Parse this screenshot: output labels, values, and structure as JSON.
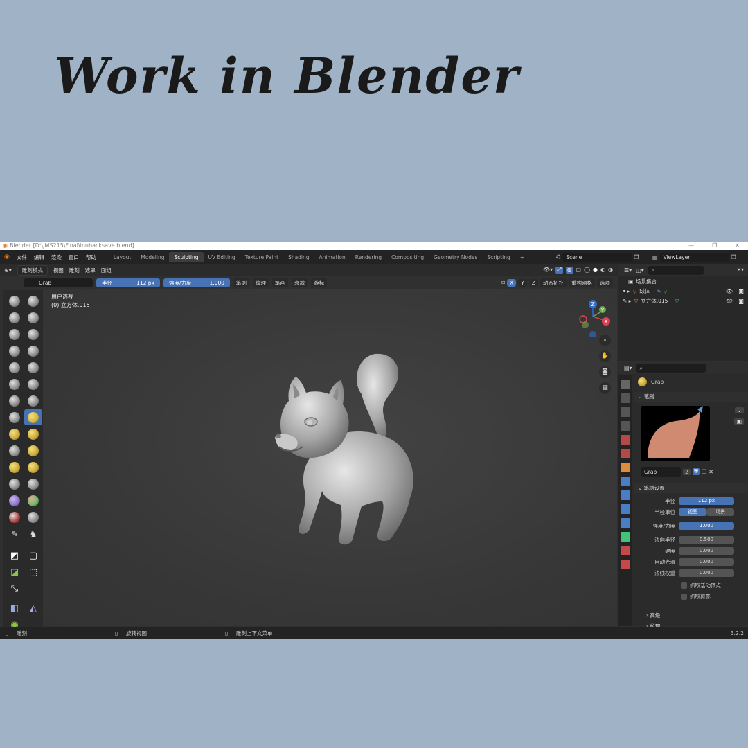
{
  "heading": "Work in Blender",
  "window": {
    "title": "Blender [D:\\JMS215\\Final\\inubacksave.blend]",
    "controls": [
      "—",
      "❐",
      "✕"
    ]
  },
  "menu": [
    "文件",
    "编辑",
    "渲染",
    "窗口",
    "帮助"
  ],
  "workspace_tabs": [
    "Layout",
    "Modeling",
    "Sculpting",
    "UV Editing",
    "Texture Paint",
    "Shading",
    "Animation",
    "Rendering",
    "Compositing",
    "Geometry Nodes",
    "Scripting"
  ],
  "active_tab": "Sculpting",
  "add_tab": "+",
  "scene": "Scene",
  "view_layer": "ViewLayer",
  "viewport_header": {
    "mode": "雕刻模式",
    "items": [
      "视图",
      "雕刻",
      "遮罩",
      "面组"
    ]
  },
  "tool_settings": {
    "brush_name": "Grab",
    "radius_label": "半径",
    "radius_value": "112 px",
    "strength_label": "强度/力度",
    "strength_value": "1.000",
    "dropdowns": [
      "笔刷",
      "纹理",
      "笔画",
      "衰减",
      "游标"
    ],
    "axes": [
      "X",
      "Y",
      "Z"
    ],
    "right_items": [
      "动态拓扑",
      "重构网格",
      "选项"
    ]
  },
  "viewport": {
    "view_name": "用户透视",
    "object_name": "(0) 立方体.015"
  },
  "gizmo_axes": {
    "z": "Z",
    "y": "Y",
    "x": "X"
  },
  "outliner": {
    "collection": "场景集合",
    "objects": [
      "球体",
      "立方体.015"
    ]
  },
  "properties": {
    "brush": "Grab",
    "brush_panel": "笔刷",
    "brush_field": "Grab",
    "user_count": "2",
    "settings_panel": "笔刷设置",
    "rows": [
      {
        "label": "半径",
        "value": "112 px"
      },
      {
        "label": "半径单位",
        "value": "视图",
        "alt": "场景"
      },
      {
        "label": "强度/力度",
        "value": "1.000"
      },
      {
        "label": "法向半径",
        "value": "0.500"
      },
      {
        "label": "硬度",
        "value": "0.000"
      },
      {
        "label": "自动光滑",
        "value": "0.000"
      },
      {
        "label": "法线权重",
        "value": "0.000"
      }
    ],
    "checkboxes": [
      "抓取活动顶点",
      "抓取剪影"
    ],
    "collapsed": [
      "高级",
      "纹理"
    ]
  },
  "status": {
    "left": "雕刻",
    "middle": "旋转视图",
    "right": "雕刻上下文菜单",
    "version": "3.2.2"
  },
  "colors": {
    "background": "#a0b3c6",
    "accent": "#4772b3",
    "blender_orange": "#e87d0d"
  }
}
